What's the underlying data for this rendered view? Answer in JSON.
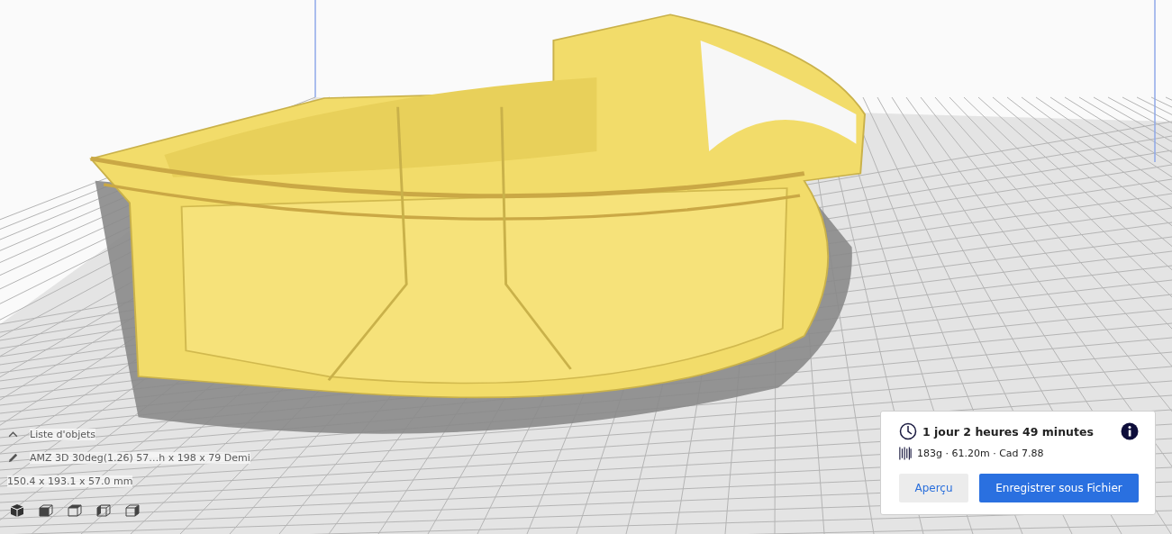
{
  "object_list": {
    "label": "Liste d'objets"
  },
  "object": {
    "name": "AMZ 3D 30deg(1.26) 57…h x 198 x 79 Demi",
    "dimensions": "150.4 x 193.1 x 57.0 mm"
  },
  "view_buttons": [
    {
      "kind": "iso"
    },
    {
      "kind": "front"
    },
    {
      "kind": "top"
    },
    {
      "kind": "left"
    },
    {
      "kind": "right"
    }
  ],
  "print_summary": {
    "time": "1 jour 2 heures 49 minutes",
    "material": "183g · 61.20m · Cad 7.88",
    "buttons": [
      {
        "label": "Aperçu",
        "kind": "secondary"
      },
      {
        "label": "Enregistrer sous Fichier",
        "kind": "primary"
      }
    ]
  }
}
